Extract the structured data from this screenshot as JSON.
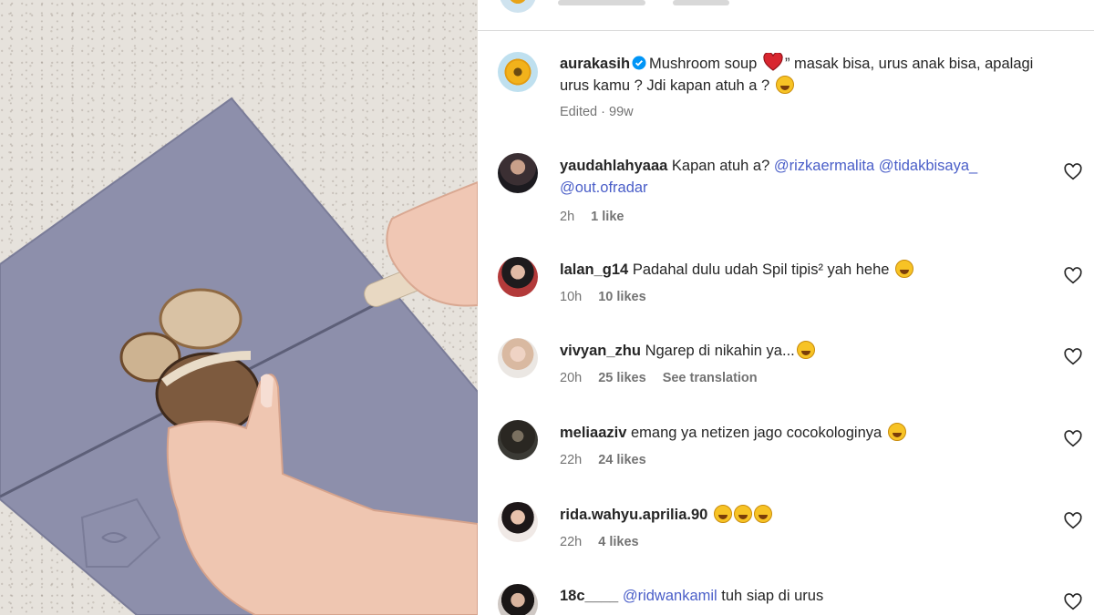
{
  "media": {
    "description_icon": "video-frame"
  },
  "caption": {
    "username": "aurakasih",
    "text_before_heart": "Mushroom soup",
    "text_after_heart": "” masak bisa, urus anak bisa, apalagi urus kamu ? Jdi kapan atuh a ?",
    "edited": "Edited",
    "separator": "·",
    "time": "99w"
  },
  "comments": [
    {
      "username": "yaudahlahyaaa",
      "text": "Kapan atuh a?",
      "mentions": [
        "@rizkaermalita",
        "@tidakbisaya_",
        "@out.ofradar"
      ],
      "time": "2h",
      "likes": "1 like"
    },
    {
      "username": "lalan_g14",
      "text": "Padahal dulu udah Spil tipis² yah hehe",
      "time": "10h",
      "likes": "10 likes"
    },
    {
      "username": "vivyan_zhu",
      "text": "Ngarep di nikahin ya...",
      "time": "20h",
      "likes": "25 likes",
      "translation": "See translation"
    },
    {
      "username": "meliaaziv",
      "text": "emang ya netizen jago cocokologinya",
      "time": "22h",
      "likes": "24 likes"
    },
    {
      "username": "rida.wahyu.aprilia.90",
      "text": "",
      "time": "22h",
      "likes": "4 likes"
    },
    {
      "username": "18c____",
      "mention": "@ridwankamil",
      "text": "tuh siap di urus"
    }
  ],
  "colors": {
    "mention": "#4a5ec8",
    "meta": "#737373",
    "verified": "#0095f6",
    "heart": "#d8262f"
  }
}
